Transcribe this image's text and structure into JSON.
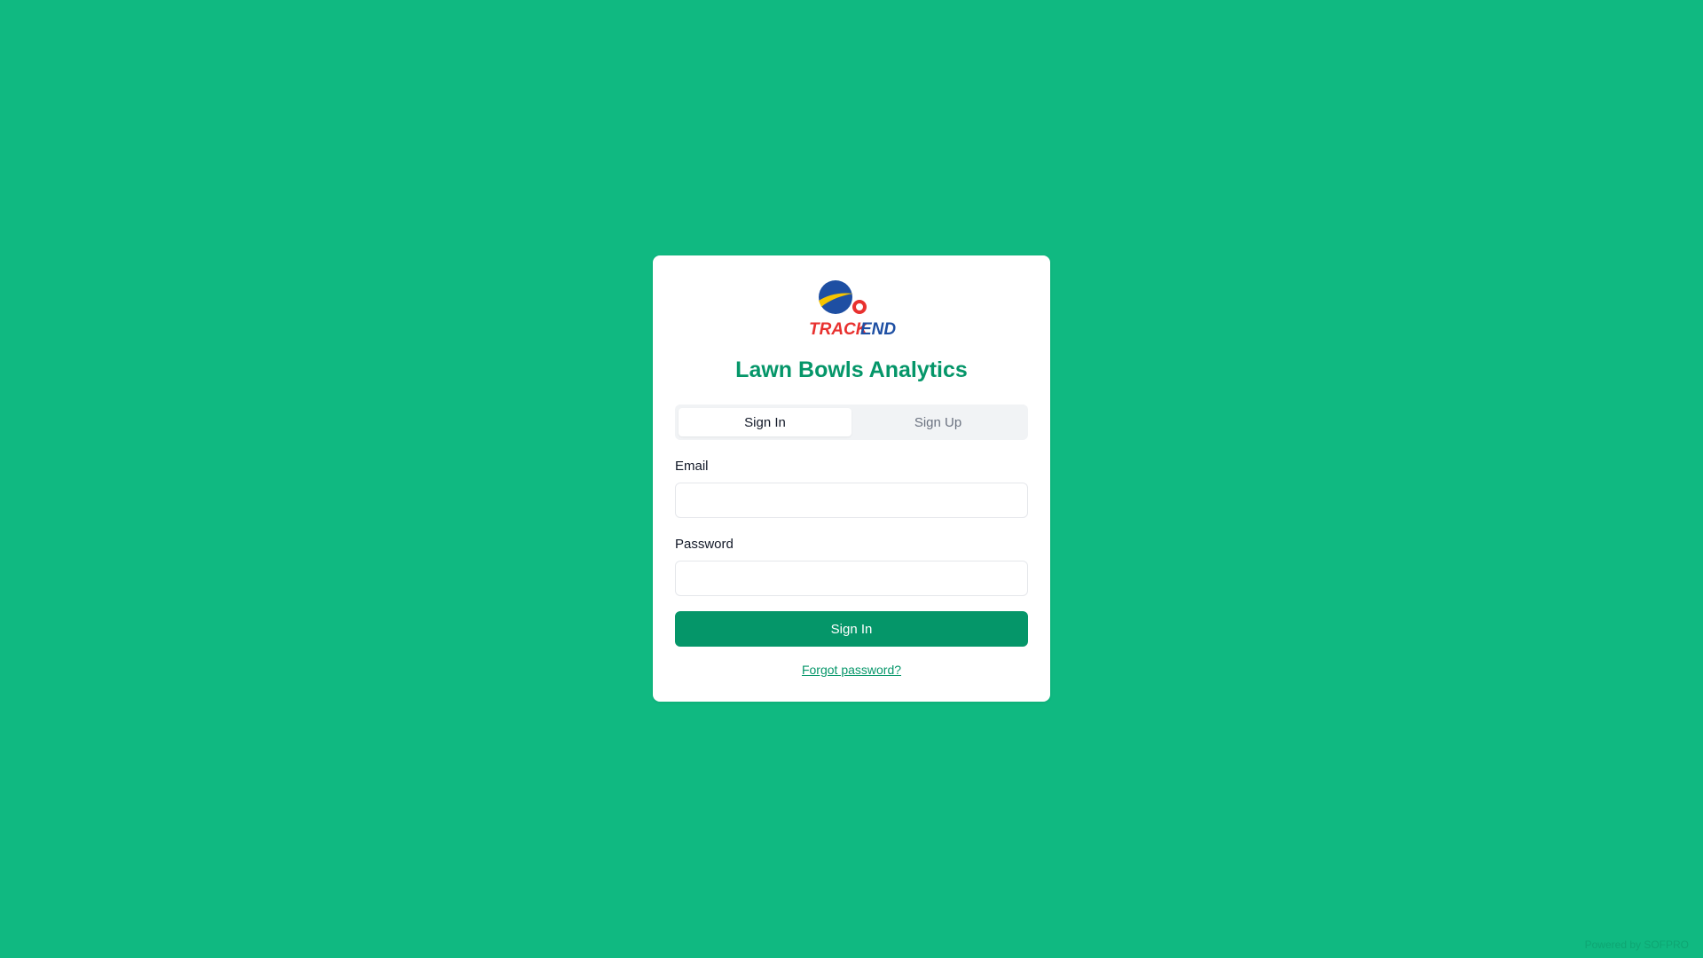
{
  "brand": {
    "logo_text": "TRACK END",
    "title": "Lawn Bowls Analytics"
  },
  "tabs": [
    {
      "label": "Sign In",
      "active": true
    },
    {
      "label": "Sign Up",
      "active": false
    }
  ],
  "form": {
    "email_label": "Email",
    "email_value": "",
    "email_placeholder": "",
    "password_label": "Password",
    "password_value": "",
    "password_placeholder": "",
    "submit_label": "Sign In",
    "forgot_label": "Forgot password?"
  },
  "footer": {
    "text": "Powered by SOFPRO"
  },
  "colors": {
    "background": "#10b981",
    "primary": "#059669",
    "card": "#ffffff",
    "logo_red": "#e8312f",
    "logo_blue": "#1e4fa3",
    "logo_yellow": "#f5c400"
  }
}
